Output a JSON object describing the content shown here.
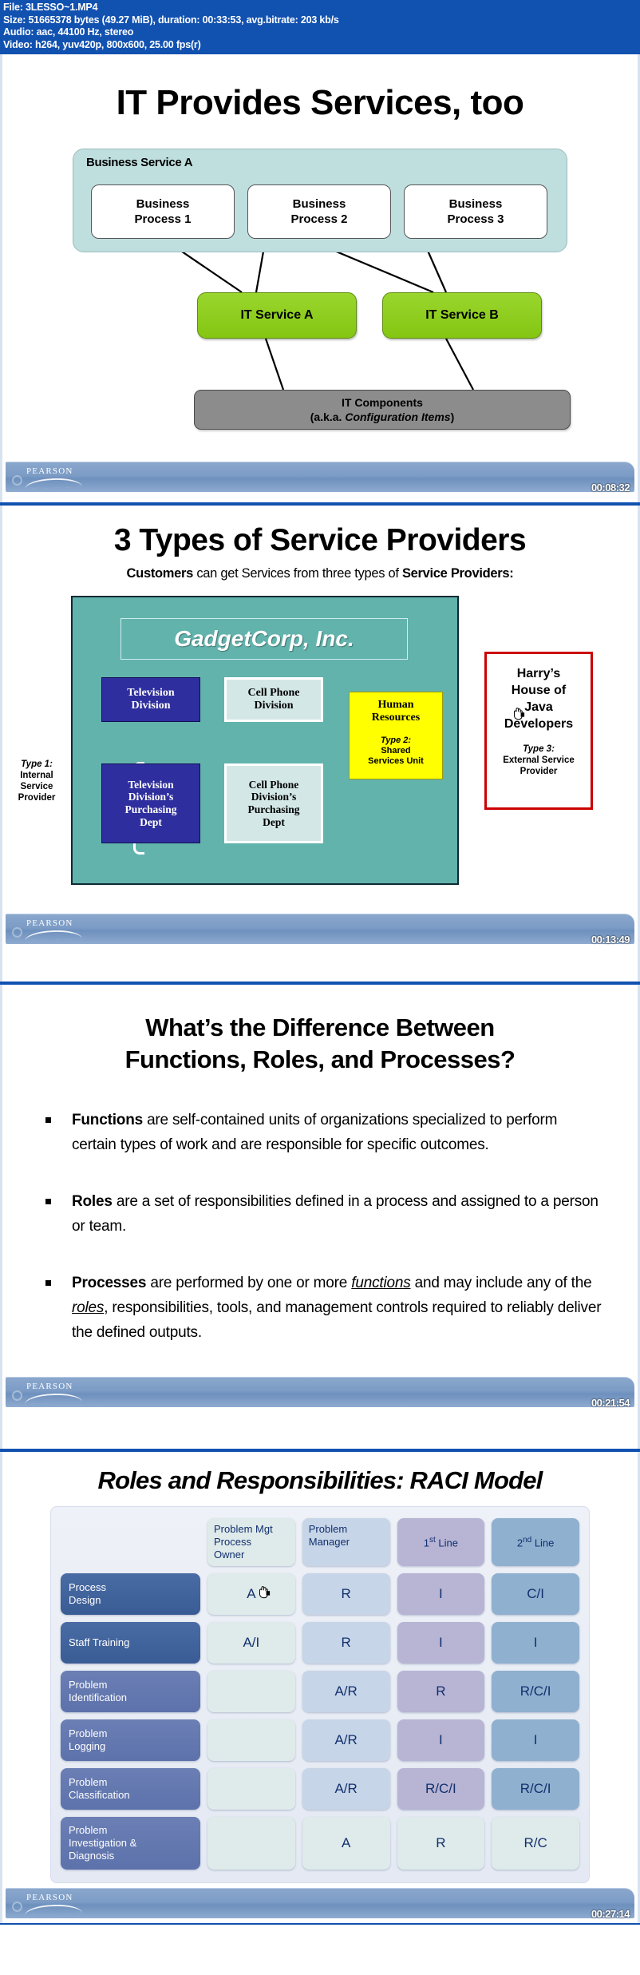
{
  "mediainfo": {
    "line1": "File: 3LESSO~1.MP4",
    "line2": "Size: 51665378 bytes (49.27 MiB), duration: 00:33:53, avg.bitrate: 203 kb/s",
    "line3": "Audio: aac, 44100 Hz, stereo",
    "line4": "Video: h264, yuv420p, 800x600, 25.00 fps(r)"
  },
  "brand": {
    "name": "PEARSON"
  },
  "colors": {
    "header_blue": "#1151b0",
    "it_service_green": "#8dce23",
    "it_components_gray": "#8c8c8c",
    "business_service_teal": "#bfdfdf",
    "gadgetcorp_teal": "#63b3ad",
    "harry_border_red": "#cc0000",
    "hr_yellow": "#ffff00",
    "tv_division_navy": "#2e2e9e",
    "footer_blue": "#7c9cc6"
  },
  "slide1": {
    "title": "IT Provides Services, too",
    "timestamp": "00:08:32",
    "business_service_label": "Business Service A",
    "business_processes": [
      "Business\nProcess 1",
      "Business\nProcess 2",
      "Business\nProcess 3"
    ],
    "bp1_line1": "Business",
    "bp1_line2": "Process 1",
    "bp2_line1": "Business",
    "bp2_line2": "Process 2",
    "bp3_line1": "Business",
    "bp3_line2": "Process 3",
    "it_services": [
      "IT Service A",
      "IT Service B"
    ],
    "it_service_a": "IT Service A",
    "it_service_b": "IT Service B",
    "it_components_line1": "IT Components",
    "it_components_aka": "(a.k.a. ",
    "it_components_italic": "Configuration Items",
    "it_components_close": ")"
  },
  "slide2": {
    "title": "3 Types of Service Providers",
    "timestamp": "00:13:49",
    "subtitle_bold1": "Customers",
    "subtitle_mid": " can get Services from three types of ",
    "subtitle_bold2": "Service Providers:",
    "company": "GadgetCorp, Inc.",
    "tv_division": "Television\nDivision",
    "tv_division_l1": "Television",
    "tv_division_l2": "Division",
    "cell_division_l1": "Cell Phone",
    "cell_division_l2": "Division",
    "hr_name_l1": "Human",
    "hr_name_l2": "Resources",
    "hr_type_label": "Type 2:",
    "hr_type_text_l1": "Shared",
    "hr_type_text_l2": "Services Unit",
    "tv_purchasing_l1": "Television",
    "tv_purchasing_l2": "Division’s",
    "tv_purchasing_l3": "Purchasing",
    "tv_purchasing_l4": "Dept",
    "cp_purchasing_l1": "Cell Phone",
    "cp_purchasing_l2": "Division’s",
    "cp_purchasing_l3": "Purchasing",
    "cp_purchasing_l4": "Dept",
    "type1_label": "Type 1:",
    "type1_l1": "Internal",
    "type1_l2": "Service",
    "type1_l3": "Provider",
    "harry_l1": "Harry’s",
    "harry_l2": "House of",
    "harry_l3": "Java",
    "harry_l4": "Developers",
    "harry_type_label": "Type 3:",
    "harry_type_l1": "External Service",
    "harry_type_l2": "Provider"
  },
  "slide3": {
    "title_l1": "What’s the Difference Between",
    "title_l2": "Functions, Roles, and Processes?",
    "timestamp": "00:21:54",
    "bullets": [
      {
        "term": "Functions",
        "rest": " are self-contained units of organizations specialized to perform certain types of work and are responsible for specific outcomes."
      },
      {
        "term": "Roles",
        "rest": " are a set of responsibilities defined in a process and assigned to a person or team."
      },
      {
        "term": "Processes",
        "rest_a": " are performed by one or more ",
        "em_a": "functions",
        "rest_b": " and may include any of the ",
        "em_b": "roles",
        "rest_c": ", responsibilities, tools, and management controls required to reliably deliver the defined outputs."
      }
    ]
  },
  "slide4": {
    "title": "Roles and Responsibilities: RACI Model",
    "timestamp": "00:27:14",
    "chart_like_table": {
      "corner": "",
      "columns": [
        "Problem Mgt Process Owner",
        "Problem Manager",
        "1st Line",
        "2nd Line"
      ],
      "col0_l1": "Problem Mgt",
      "col0_l2": "Process",
      "col0_l3": "Owner",
      "col1_l1": "Problem",
      "col1_l2": "Manager",
      "col2_num": "1",
      "col2_sup": "st",
      "col2_rest": " Line",
      "col3_num": "2",
      "col3_sup": "nd",
      "col3_rest": " Line",
      "rows": [
        {
          "label_l1": "Process",
          "label_l2": "Design",
          "label_l3": "",
          "values": [
            "A",
            "R",
            "I",
            "C/I"
          ]
        },
        {
          "label_l1": "Staff Training",
          "label_l2": "",
          "label_l3": "",
          "values": [
            "A/I",
            "R",
            "I",
            "I"
          ]
        },
        {
          "label_l1": "Problem",
          "label_l2": "Identification",
          "label_l3": "",
          "values": [
            "",
            "A/R",
            "R",
            "R/C/I"
          ]
        },
        {
          "label_l1": "Problem",
          "label_l2": "Logging",
          "label_l3": "",
          "values": [
            "",
            "A/R",
            "I",
            "I"
          ]
        },
        {
          "label_l1": "Problem",
          "label_l2": "Classification",
          "label_l3": "",
          "values": [
            "",
            "A/R",
            "R/C/I",
            "R/C/I"
          ]
        },
        {
          "label_l1": "Problem",
          "label_l2": "Investigation &",
          "label_l3": "Diagnosis",
          "values": [
            "",
            "A",
            "R",
            "R/C"
          ]
        }
      ]
    }
  }
}
